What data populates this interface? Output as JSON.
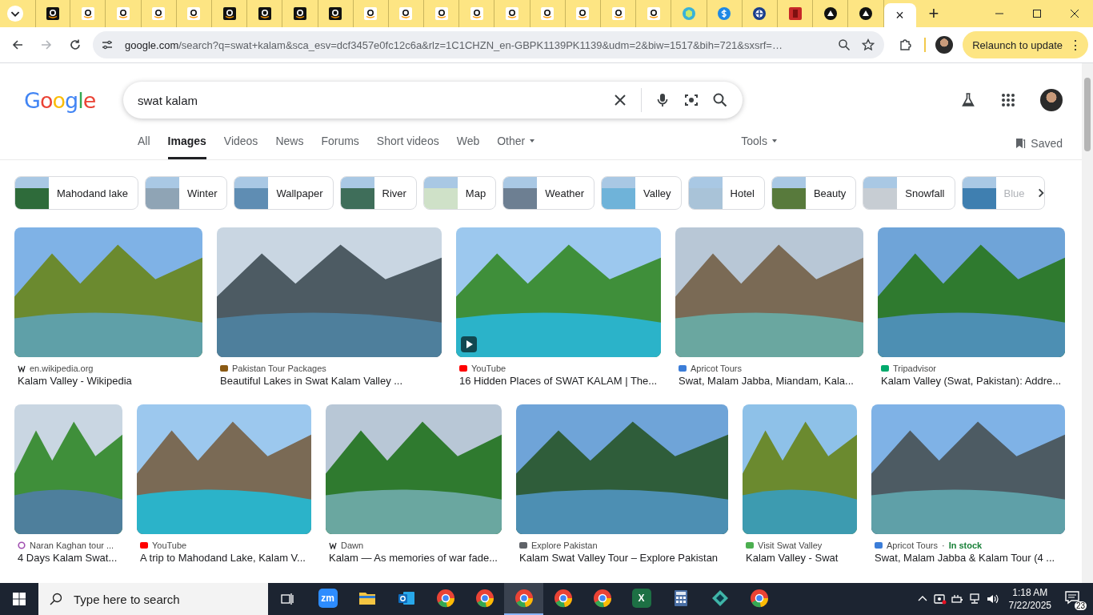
{
  "tab_strip": {
    "tabs": [
      {
        "kind": "dark",
        "selected": false
      },
      {
        "kind": "light",
        "selected": false
      },
      {
        "kind": "light",
        "selected": false
      },
      {
        "kind": "light",
        "selected": false
      },
      {
        "kind": "light",
        "selected": false
      },
      {
        "kind": "dark",
        "selected": false
      },
      {
        "kind": "dark",
        "selected": false
      },
      {
        "kind": "dark",
        "selected": false
      },
      {
        "kind": "dark",
        "selected": false
      },
      {
        "kind": "light",
        "selected": false
      },
      {
        "kind": "light",
        "selected": false
      },
      {
        "kind": "light",
        "selected": false
      },
      {
        "kind": "light",
        "selected": false
      },
      {
        "kind": "light",
        "selected": false
      },
      {
        "kind": "light",
        "selected": false
      },
      {
        "kind": "light",
        "selected": false
      },
      {
        "kind": "light",
        "selected": false
      },
      {
        "kind": "light",
        "selected": false
      },
      {
        "kind": "hexagon",
        "selected": false
      },
      {
        "kind": "dollar",
        "selected": false
      },
      {
        "kind": "cross",
        "selected": false
      },
      {
        "kind": "figure",
        "selected": false
      },
      {
        "kind": "triangle",
        "selected": false
      },
      {
        "kind": "triangle",
        "selected": false
      },
      {
        "selected": true
      }
    ],
    "close": "×",
    "new_tab": "+"
  },
  "toolbar": {
    "forward_disabled": true,
    "url_host": "google.com",
    "url_rest": "/search?q=swat+kalam&sca_esv=dcf3457e0fc12c6a&rlz=1C1CHZN_en-GBPK1139PK1139&udm=2&biw=1517&bih=721&sxsrf=…",
    "relaunch": "Relaunch to update",
    "menu": "⋮"
  },
  "header": {
    "logo": "Google",
    "query": "swat kalam"
  },
  "nav": {
    "tabs": [
      {
        "label": "All",
        "selected": false,
        "dropdown": false
      },
      {
        "label": "Images",
        "selected": true,
        "dropdown": false
      },
      {
        "label": "Videos",
        "selected": false,
        "dropdown": false
      },
      {
        "label": "News",
        "selected": false,
        "dropdown": false
      },
      {
        "label": "Forums",
        "selected": false,
        "dropdown": false
      },
      {
        "label": "Short videos",
        "selected": false,
        "dropdown": false
      },
      {
        "label": "Web",
        "selected": false,
        "dropdown": false
      },
      {
        "label": "Other",
        "selected": false,
        "dropdown": true
      }
    ],
    "tools": "Tools",
    "saved": "Saved"
  },
  "chips": [
    {
      "label": "Mahodand lake",
      "faded": false
    },
    {
      "label": "Winter",
      "faded": false
    },
    {
      "label": "Wallpaper",
      "faded": false
    },
    {
      "label": "River",
      "faded": false
    },
    {
      "label": "Map",
      "faded": false
    },
    {
      "label": "Weather",
      "faded": false
    },
    {
      "label": "Valley",
      "faded": false
    },
    {
      "label": "Hotel",
      "faded": false
    },
    {
      "label": "Beauty",
      "faded": false
    },
    {
      "label": "Snowfall",
      "faded": false
    },
    {
      "label": "Blue",
      "faded": true
    }
  ],
  "results": [
    [
      {
        "kind": "wiki",
        "source": "en.wikipedia.org",
        "title": "Kalam Valley - Wikipedia",
        "video": false
      },
      {
        "kind": "square",
        "source": "Pakistan Tour Packages",
        "title": "Beautiful Lakes in Swat Kalam Valley ...",
        "video": false
      },
      {
        "kind": "youtube",
        "source": "YouTube",
        "title": "16 Hidden Places of SWAT KALAM | The...",
        "video": true
      },
      {
        "kind": "apricot",
        "source": "Apricot Tours",
        "title": "Swat, Malam Jabba, Miandam, Kala...",
        "video": false
      },
      {
        "kind": "tripadvisor",
        "source": "Tripadvisor",
        "title": "Kalam Valley (Swat, Pakistan): Addre...",
        "video": false
      }
    ],
    [
      {
        "kind": "ring",
        "source": "Naran Kaghan tour ...",
        "title": "4 Days Kalam Swat...",
        "video": false
      },
      {
        "kind": "youtube",
        "source": "YouTube",
        "title": "A trip to Mahodand Lake, Kalam V...",
        "video": false
      },
      {
        "kind": "dawn",
        "source": "Dawn",
        "title": "Kalam — As memories of war fade...",
        "video": false
      },
      {
        "kind": "explore",
        "source": "Explore Pakistan",
        "title": "Kalam Swat Valley Tour – Explore Pakistan",
        "video": false
      },
      {
        "kind": "visit",
        "source": "Visit Swat Valley",
        "title": "Kalam Valley - Swat",
        "video": false
      },
      {
        "kind": "apricot",
        "source": "Apricot Tours",
        "separator": "·",
        "stock": "In stock",
        "title": "Swat, Malam Jabba & Kalam Tour (4 ...",
        "video": false
      }
    ]
  ],
  "taskbar": {
    "search_placeholder": "Type here to search",
    "apps": [
      {
        "kind": "zoom",
        "label": "zm",
        "selected": false
      },
      {
        "kind": "folder",
        "selected": false
      },
      {
        "kind": "outlook",
        "selected": false
      },
      {
        "kind": "chrome",
        "selected": false
      },
      {
        "kind": "chrome",
        "selected": false
      },
      {
        "kind": "chrome",
        "selected": true
      },
      {
        "kind": "chrome",
        "selected": false
      },
      {
        "kind": "chrome",
        "selected": false
      },
      {
        "kind": "excel",
        "label": "X",
        "selected": false
      },
      {
        "kind": "calculator",
        "selected": false
      },
      {
        "kind": "diamond",
        "selected": false
      },
      {
        "kind": "chrome",
        "selected": false
      }
    ],
    "time": "1:18 AM",
    "date": "7/22/2025",
    "notifications": "23"
  }
}
